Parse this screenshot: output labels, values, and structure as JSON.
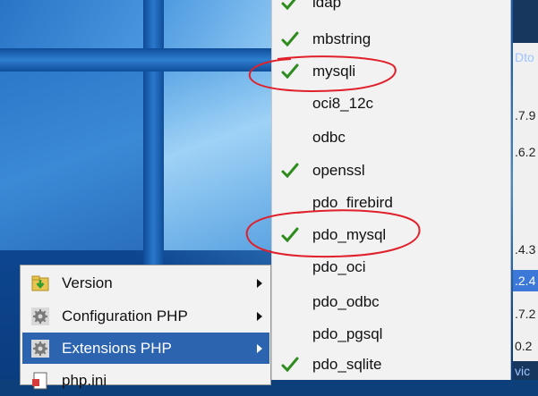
{
  "submenu": {
    "items": [
      {
        "label": "ldap",
        "checked": true
      },
      {
        "label": "mbstring",
        "checked": true
      },
      {
        "label": "mysqli",
        "checked": true
      },
      {
        "label": "oci8_12c",
        "checked": false
      },
      {
        "label": "odbc",
        "checked": false
      },
      {
        "label": "openssl",
        "checked": true
      },
      {
        "label": "pdo_firebird",
        "checked": false
      },
      {
        "label": "pdo_mysql",
        "checked": true
      },
      {
        "label": "pdo_oci",
        "checked": false
      },
      {
        "label": "pdo_odbc",
        "checked": false
      },
      {
        "label": "pdo_pgsql",
        "checked": false
      },
      {
        "label": "pdo_sqlite",
        "checked": true
      }
    ]
  },
  "menu": {
    "items": [
      {
        "label": "Version",
        "icon": "folder-arrow-icon",
        "has_submenu": true,
        "active": false
      },
      {
        "label": "Configuration PHP",
        "icon": "gear-icon",
        "has_submenu": true,
        "active": false
      },
      {
        "label": "Extensions PHP",
        "icon": "gear-icon",
        "has_submenu": true,
        "active": true
      },
      {
        "label": "php.ini",
        "icon": "document-icon",
        "has_submenu": false,
        "active": false
      }
    ]
  },
  "right_window": {
    "fragments": [
      "Dto",
      ".7.9",
      ".6.2",
      ".4.3",
      ".2.4",
      ".7.2",
      "0.2",
      "vic"
    ]
  },
  "colors": {
    "check": "#2e8b1e",
    "highlight": "#2d64b0",
    "annotation": "#e0202a"
  }
}
